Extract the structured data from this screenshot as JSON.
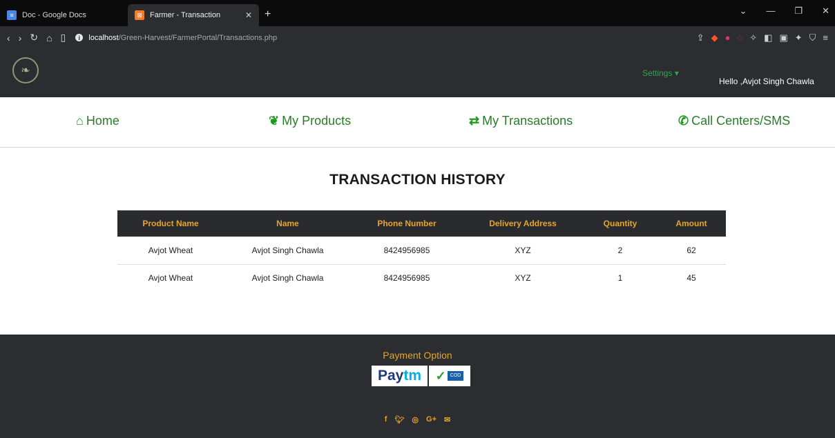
{
  "browser": {
    "tabs": [
      {
        "title": "Doc - Google Docs"
      },
      {
        "title": "Farmer - Transaction"
      }
    ],
    "url_host": "localhost",
    "url_path": "/Green-Harvest/FarmerPortal/Transactions.php"
  },
  "header": {
    "settings_label": "Settings",
    "greeting": "Hello ,Avjot Singh Chawla"
  },
  "nav": {
    "home": "Home",
    "products": "My Products",
    "transactions": "My Transactions",
    "call_centers": "Call Centers/SMS"
  },
  "page": {
    "title": "TRANSACTION HISTORY"
  },
  "table": {
    "headers": [
      "Product Name",
      "Name",
      "Phone Number",
      "Delivery Address",
      "Quantity",
      "Amount"
    ],
    "rows": [
      [
        "Avjot Wheat",
        "Avjot Singh Chawla",
        "8424956985",
        "XYZ",
        "2",
        "62"
      ],
      [
        "Avjot Wheat",
        "Avjot Singh Chawla",
        "8424956985",
        "XYZ",
        "1",
        "45"
      ]
    ]
  },
  "footer": {
    "payment_title": "Payment Option",
    "paytm_part1": "Pay",
    "paytm_part2": "tm",
    "cod_label": "COD"
  },
  "colors": {
    "accent_orange": "#e6a52a",
    "nav_green": "#2a7a2a",
    "header_bg": "#2b2d30"
  }
}
